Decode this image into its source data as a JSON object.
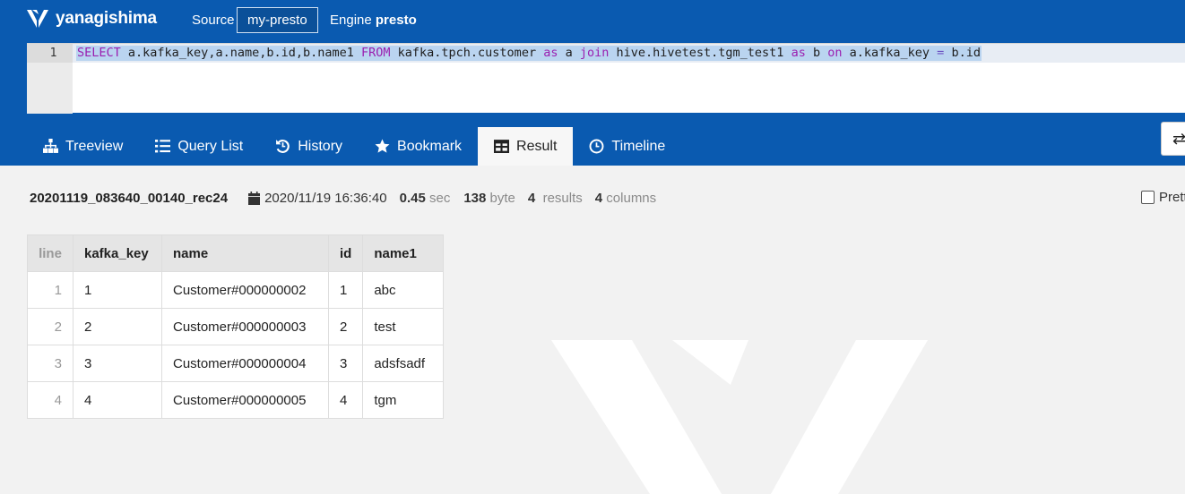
{
  "app": {
    "brand": "yanagishima"
  },
  "header": {
    "source_label": "Source",
    "source_value": "my-presto",
    "engine_label": "Engine",
    "engine_value": "presto"
  },
  "editor": {
    "line_number": "1",
    "tokens": [
      {
        "t": "SELECT",
        "c": "kw"
      },
      {
        "t": " a.kafka_key,a.name,b.id,b.name1 ",
        "c": ""
      },
      {
        "t": "FROM",
        "c": "kw"
      },
      {
        "t": " kafka.tpch.customer ",
        "c": ""
      },
      {
        "t": "as",
        "c": "kw"
      },
      {
        "t": " a ",
        "c": ""
      },
      {
        "t": "join",
        "c": "kw"
      },
      {
        "t": " hive.hivetest.tgm_test1 ",
        "c": ""
      },
      {
        "t": "as",
        "c": "kw"
      },
      {
        "t": " b ",
        "c": ""
      },
      {
        "t": "on",
        "c": "kw"
      },
      {
        "t": " a.kafka_key ",
        "c": ""
      },
      {
        "t": "=",
        "c": "op"
      },
      {
        "t": " b.id",
        "c": ""
      }
    ]
  },
  "tabs": [
    {
      "label": "Treeview",
      "icon": "sitemap-icon"
    },
    {
      "label": "Query List",
      "icon": "list-icon"
    },
    {
      "label": "History",
      "icon": "history-icon"
    },
    {
      "label": "Bookmark",
      "icon": "star-icon"
    },
    {
      "label": "Result",
      "icon": "table-icon",
      "active": true
    },
    {
      "label": "Timeline",
      "icon": "clock-icon"
    }
  ],
  "side_button": {
    "icon": "exchange-icon",
    "glyph": "⇄"
  },
  "result": {
    "query_id": "20201119_083640_00140_rec24",
    "date": "2020/11/19 16:36:40",
    "elapsed": "0.45",
    "elapsed_unit": "sec",
    "size": "138",
    "size_unit": "byte",
    "results_count": "4",
    "results_label": "results",
    "columns_count": "4",
    "columns_label": "columns",
    "pretty_label": "Pretty"
  },
  "table": {
    "headers": [
      "line",
      "kafka_key",
      "name",
      "id",
      "name1"
    ],
    "rows": [
      [
        "1",
        "1",
        "Customer#000000002",
        "1",
        "abc"
      ],
      [
        "2",
        "2",
        "Customer#000000003",
        "2",
        "test"
      ],
      [
        "3",
        "3",
        "Customer#000000004",
        "3",
        "adsfsadf"
      ],
      [
        "4",
        "4",
        "Customer#000000005",
        "4",
        "tgm"
      ]
    ]
  },
  "colors": {
    "header_bg": "#0a5ab0",
    "keyword": "#9b1fb0",
    "selection": "#bad4f0"
  }
}
